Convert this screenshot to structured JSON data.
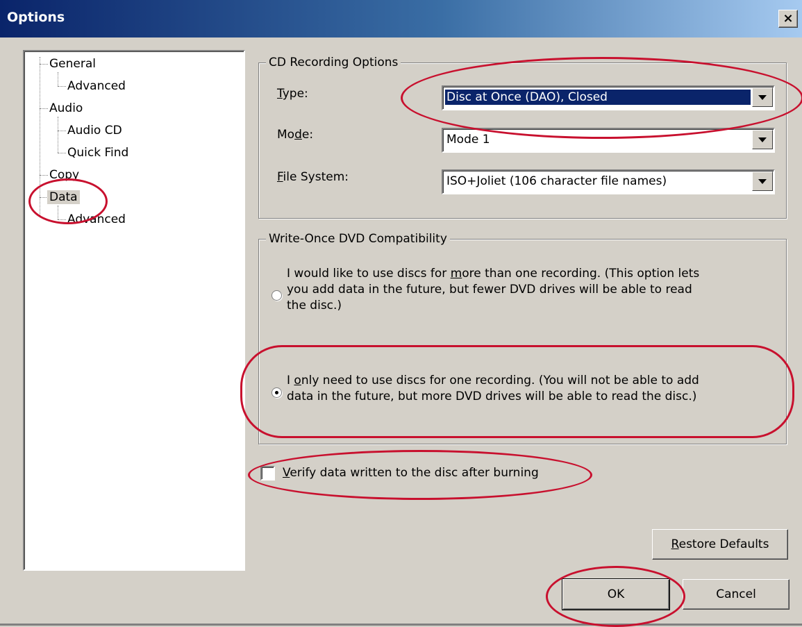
{
  "window": {
    "title": "Options",
    "close_glyph": "×"
  },
  "tree": {
    "items": [
      {
        "label": "General"
      },
      {
        "label": "Advanced"
      },
      {
        "label": "Audio"
      },
      {
        "label": "Audio CD"
      },
      {
        "label": "Quick Find"
      },
      {
        "label": "Copy"
      },
      {
        "label": "Data"
      },
      {
        "label": "Advanced"
      }
    ],
    "selected": "Data"
  },
  "cd_recording": {
    "legend": "CD Recording Options",
    "type": {
      "label_pre": "",
      "label_mn": "T",
      "label_post": "ype:",
      "value": "Disc at Once (DAO), Closed"
    },
    "mode": {
      "label_pre": "Mo",
      "label_mn": "d",
      "label_post": "e:",
      "value": "Mode 1"
    },
    "file_system": {
      "label_pre": "",
      "label_mn": "F",
      "label_post": "ile System:",
      "value": "ISO+Joliet (106 character file names)"
    }
  },
  "dvd_compat": {
    "legend": "Write-Once DVD Compatibility",
    "option_multi": {
      "line1_pre": "I would like to use discs for ",
      "line1_mn": "m",
      "line1_post": "ore than one recording. (This option lets",
      "line2": "you add data in the future, but fewer DVD drives will be able to read",
      "line3": "the disc.)",
      "selected": false
    },
    "option_single": {
      "line1_pre": "I ",
      "line1_mn": "o",
      "line1_post": "nly need to use discs for one recording. (You will not be able to add",
      "line2": "data in the future, but more DVD drives will be able to read the disc.)",
      "selected": true
    }
  },
  "verify": {
    "label_mn": "V",
    "label_post": "erify data written to the disc after burning",
    "checked": false
  },
  "buttons": {
    "restore_mn": "R",
    "restore_post": "estore Defaults",
    "ok": "OK",
    "cancel": "Cancel"
  },
  "annotation_color": "#c8102e"
}
